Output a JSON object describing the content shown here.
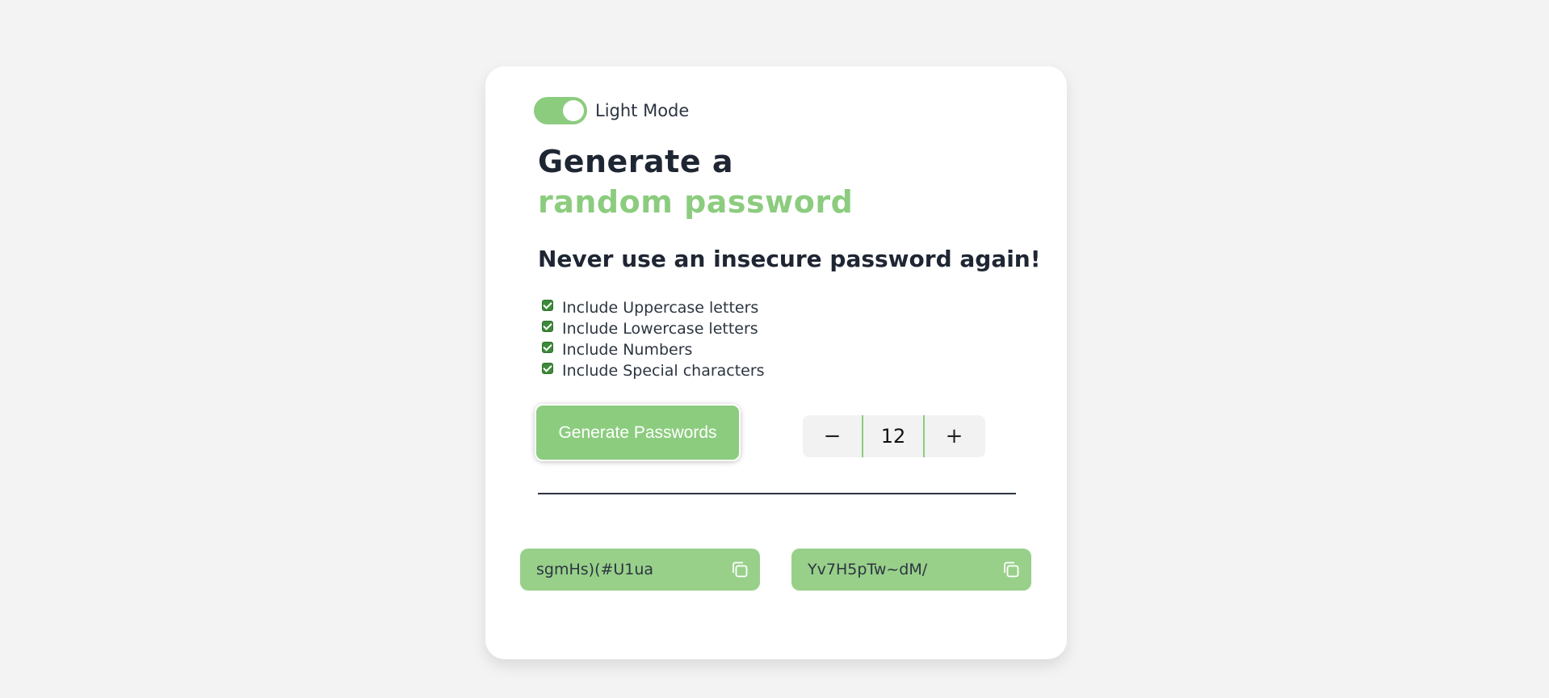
{
  "theme": {
    "accent": "#8ccc7f",
    "password_bg": "#98d08a",
    "page_bg": "#f3f3f3"
  },
  "mode_toggle": {
    "label": "Light Mode",
    "on": true
  },
  "heading": {
    "line1": "Generate a",
    "line2": "random password",
    "subtitle": "Never use an insecure password again!"
  },
  "options": [
    {
      "label": "Include Uppercase letters",
      "checked": true
    },
    {
      "label": "Include Lowercase letters",
      "checked": true
    },
    {
      "label": "Include Numbers",
      "checked": true
    },
    {
      "label": "Include Special characters",
      "checked": true
    }
  ],
  "generate_button": {
    "label": "Generate Passwords"
  },
  "length_stepper": {
    "decrement": "−",
    "value": "12",
    "increment": "+"
  },
  "passwords": [
    {
      "value": "sgmHs)(#U1ua",
      "icon": "copy-icon"
    },
    {
      "value": "Yv7H5pTw~dM/",
      "icon": "copy-icon"
    }
  ]
}
